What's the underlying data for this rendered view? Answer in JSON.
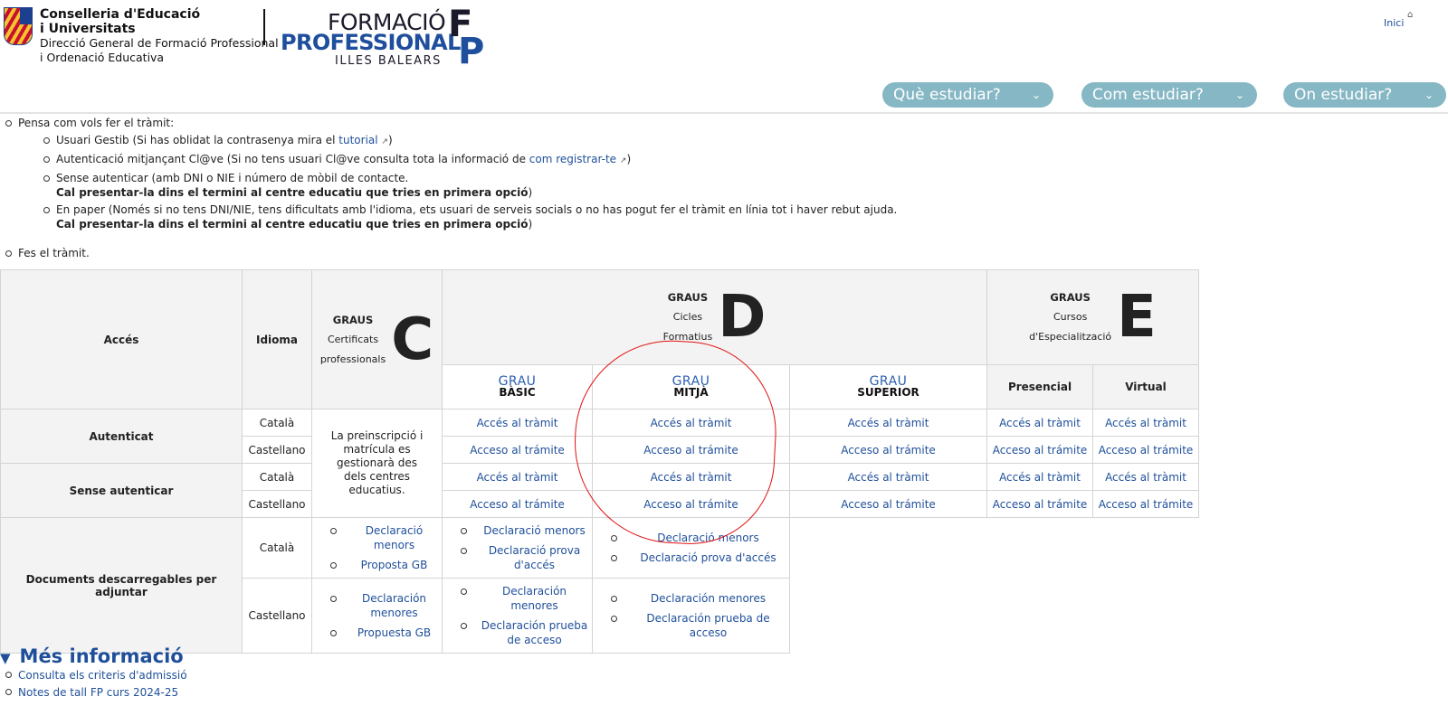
{
  "header": {
    "org_line1": "Conselleria d'Educació",
    "org_line2": "i Universitats",
    "org_line3": "Direcció General de Formació Professional",
    "org_line4": "i Ordenació Educativa",
    "fp_line1": "FORMACIÓ",
    "fp_line2": "PROFESSIONAL",
    "fp_line3": "ILLES BALEARS",
    "fp_f": "F",
    "fp_p": "P",
    "inici": "Inici",
    "nav": [
      {
        "label": "Què estudiar?"
      },
      {
        "label": "Com estudiar?"
      },
      {
        "label": "On estudiar?"
      }
    ]
  },
  "instructions": {
    "intro": "Pensa com vols fer el tràmit:",
    "o1_text": "Usuari Gestib (Si has oblidat la contrasenya mira el ",
    "o1_link": "tutorial",
    "o1_end": ")",
    "o2_text": "Autenticació mitjançant Cl@ve (Si no tens usuari Cl@ve consulta tota la informació de ",
    "o2_link": "com registrar-te",
    "o2_end": ")",
    "o3_text": "Sense autenticar (amb DNI o NIE i número de mòbil de contacte.",
    "o3_bold": "Cal presentar-la dins el termini al centre educatiu que tries en primera opció",
    "o3_end": ")",
    "o4_text": "En paper (Només si no tens DNI/NIE, tens dificultats amb l'idioma, ets usuari de serveis socials o no has pogut fer el tràmit en línia tot i haver rebut ajuda.",
    "o4_bold": "Cal presentar-la dins el termini al centre educatiu que tries en primera opció",
    "o4_end": ")",
    "fes": "Fes el tràmit."
  },
  "table": {
    "acces": "Accés",
    "idioma": "Idioma",
    "graus": "GRAUS",
    "c_sub1": "Certificats",
    "c_sub2": "professionals",
    "c_letter": "C",
    "d_sub1": "Cicles",
    "d_sub2": "Formatius",
    "d_letter": "D",
    "e_sub1": "Cursos",
    "e_sub2": "d'Especialització",
    "e_letter": "E",
    "grau": "GRAU",
    "basic": "BÀSIC",
    "mitja": "MITJÀ",
    "superior": "SUPERIOR",
    "presencial": "Presencial",
    "virtual": "Virtual",
    "autenticat": "Autenticat",
    "sense": "Sense autenticar",
    "documents": "Documents descarregables per adjuntar",
    "catala": "Català",
    "castellano": "Castellano",
    "acces_tramit": "Accés al tràmit",
    "acceso_tramite": "Acceso al trámite",
    "preinscripcio": "La preinscripció i matrícula es gestionarà des dels centres educatius.",
    "decl_menors": "Declaració menors",
    "proposta_gb": "Proposta GB",
    "decl_prova": "Declaració prova d'accés",
    "decl_menores": "Declaración menores",
    "propuesta_gb": "Propuesta GB",
    "decl_prueba": "Declaración prueba de acceso"
  },
  "mes_info": {
    "title": "Més informació",
    "items": [
      "Consulta els criteris d'admissió",
      "Notes de tall FP curs 2024-25"
    ]
  }
}
